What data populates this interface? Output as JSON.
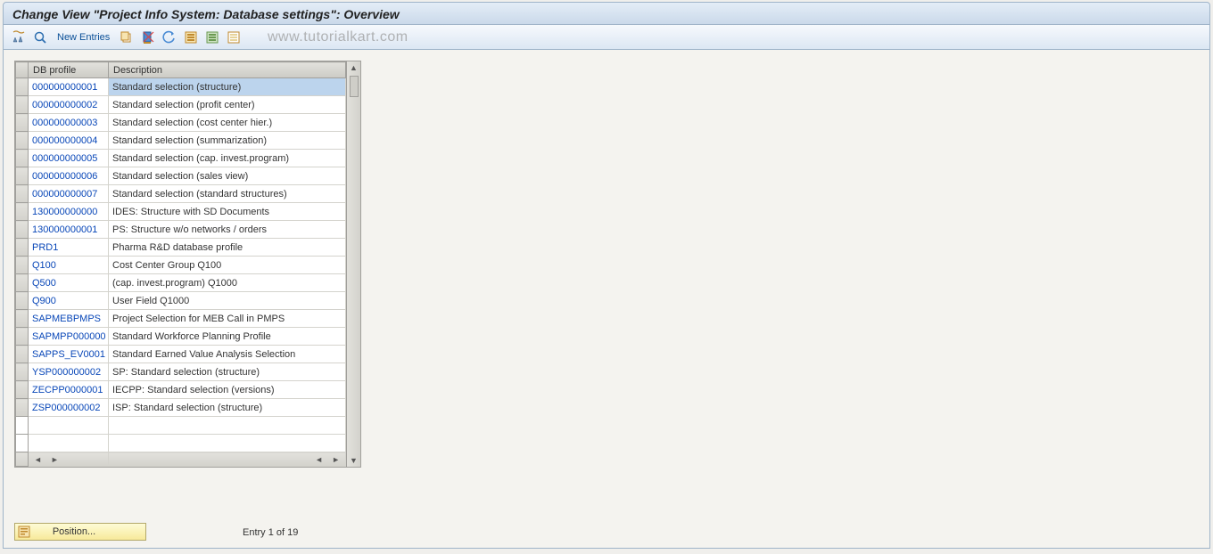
{
  "title": "Change View \"Project Info System: Database settings\": Overview",
  "toolbar": {
    "new_entries": "New Entries"
  },
  "watermark": "www.tutorialkart.com",
  "table": {
    "headers": {
      "profile": "DB profile",
      "description": "Description"
    },
    "rows": [
      {
        "profile": "000000000001",
        "description": "Standard selection (structure)",
        "selected": true
      },
      {
        "profile": "000000000002",
        "description": "Standard selection (profit center)"
      },
      {
        "profile": "000000000003",
        "description": "Standard selection (cost center hier.)"
      },
      {
        "profile": "000000000004",
        "description": "Standard selection (summarization)"
      },
      {
        "profile": "000000000005",
        "description": "Standard selection (cap. invest.program)"
      },
      {
        "profile": "000000000006",
        "description": "Standard selection (sales view)"
      },
      {
        "profile": "000000000007",
        "description": "Standard selection (standard structures)"
      },
      {
        "profile": "130000000000",
        "description": "IDES: Structure with SD Documents"
      },
      {
        "profile": "130000000001",
        "description": "PS: Structure w/o networks / orders"
      },
      {
        "profile": "PRD1",
        "description": "Pharma R&D database profile"
      },
      {
        "profile": "Q100",
        "description": "Cost Center  Group Q100"
      },
      {
        "profile": "Q500",
        "description": " (cap. invest.program) Q1000"
      },
      {
        "profile": "Q900",
        "description": "User Field Q1000"
      },
      {
        "profile": "SAPMEBPMPS",
        "description": "Project Selection for MEB Call in PMPS"
      },
      {
        "profile": "SAPMPP000000",
        "description": "Standard Workforce Planning Profile"
      },
      {
        "profile": "SAPPS_EV0001",
        "description": "Standard Earned Value Analysis Selection"
      },
      {
        "profile": "YSP000000002",
        "description": "SP: Standard selection (structure)"
      },
      {
        "profile": "ZECPP0000001",
        "description": "IECPP: Standard selection (versions)"
      },
      {
        "profile": "ZSP000000002",
        "description": "ISP: Standard selection (structure)"
      }
    ]
  },
  "footer": {
    "position_label": "Position...",
    "entry_info": "Entry 1 of 19"
  }
}
